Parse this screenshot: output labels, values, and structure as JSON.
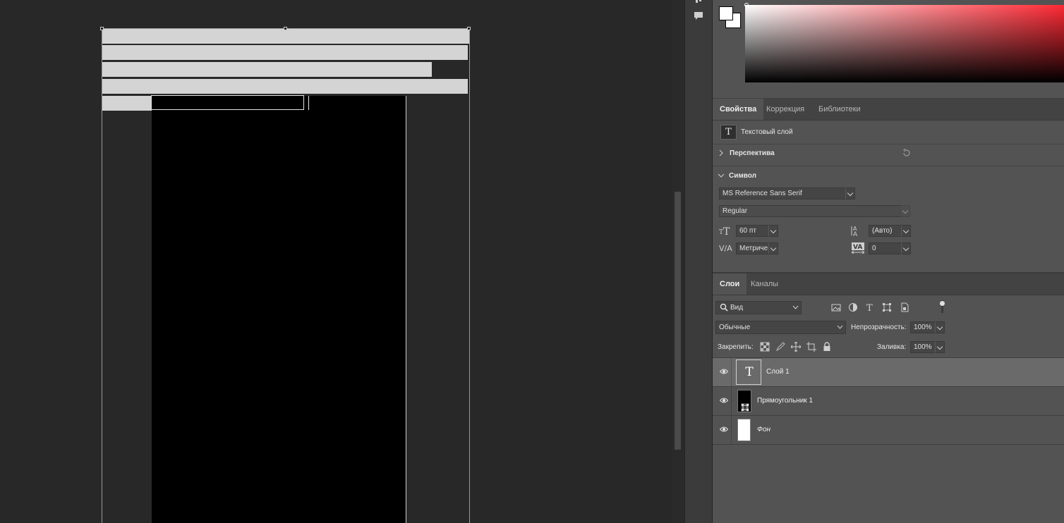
{
  "colors": {
    "app_bg": "#282828",
    "panel_bg": "#535353",
    "canvas_gray_bars": "#d4d4d4",
    "selected_layer": "#6a6a6a"
  },
  "properties_tabs": [
    {
      "label": "Свойства",
      "active": true
    },
    {
      "label": "Коррекция",
      "active": false
    },
    {
      "label": "Библиотеки",
      "active": false
    }
  ],
  "properties": {
    "layer_kind_icon": "T",
    "layer_kind": "Текстовый слой",
    "perspective_section": "Перспектива",
    "symbol_section": "Символ",
    "font_family": "MS Reference Sans Serif",
    "font_style": "Regular",
    "font_size": "60 пт",
    "leading": "(Авто)",
    "kerning": "Метриче",
    "tracking": "0"
  },
  "layers_tabs": [
    {
      "label": "Слои",
      "active": true
    },
    {
      "label": "Каналы",
      "active": false
    }
  ],
  "layers_toolbar": {
    "filter_label": "Вид",
    "blend_mode": "Обычные",
    "opacity_label": "Непрозрачность:",
    "opacity_value": "100%",
    "lock_label": "Закрепить:",
    "fill_label": "Заливка:",
    "fill_value": "100%"
  },
  "layers": [
    {
      "name": "Слой 1",
      "type": "text",
      "thumb_glyph": "T",
      "selected": true
    },
    {
      "name": "Прямоугольник 1",
      "type": "shape",
      "selected": false
    },
    {
      "name": "Фон",
      "type": "background",
      "selected": false
    }
  ]
}
